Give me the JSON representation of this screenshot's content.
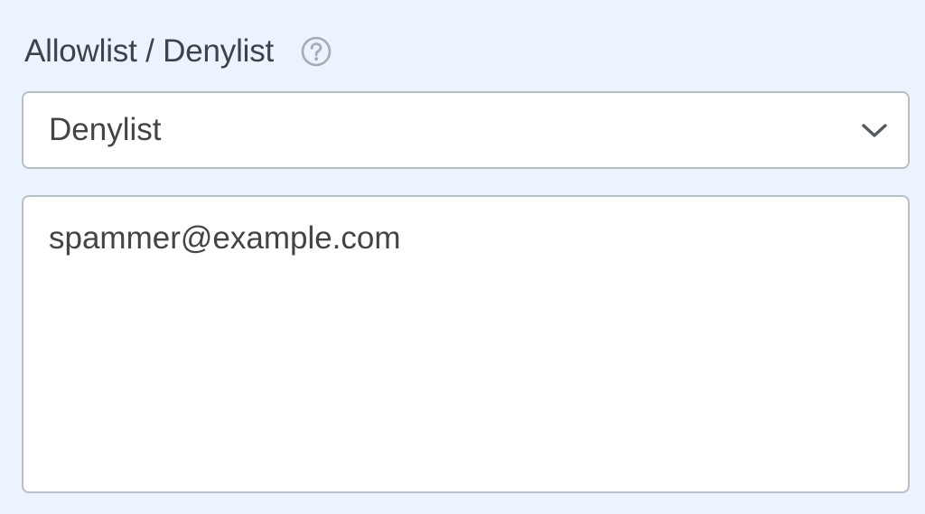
{
  "field": {
    "label": "Allowlist / Denylist",
    "help_icon": "question-circle-icon"
  },
  "mode_select": {
    "selected": "Denylist",
    "icon": "chevron-down-icon"
  },
  "email_list": {
    "value": "spammer@example.com"
  },
  "colors": {
    "background": "#ebf3fc",
    "border": "#b9bfc7",
    "text": "#444444",
    "icon": "#a6acb3"
  }
}
